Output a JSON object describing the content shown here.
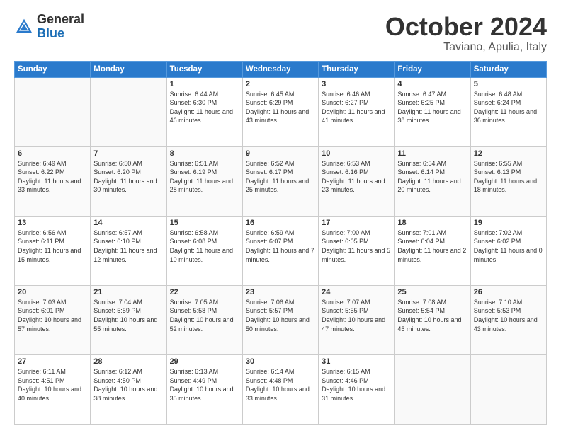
{
  "header": {
    "logo": {
      "general": "General",
      "blue": "Blue"
    },
    "title": "October 2024",
    "location": "Taviano, Apulia, Italy"
  },
  "weekdays": [
    "Sunday",
    "Monday",
    "Tuesday",
    "Wednesday",
    "Thursday",
    "Friday",
    "Saturday"
  ],
  "weeks": [
    [
      {
        "day": "",
        "info": ""
      },
      {
        "day": "",
        "info": ""
      },
      {
        "day": "1",
        "info": "Sunrise: 6:44 AM\nSunset: 6:30 PM\nDaylight: 11 hours and 46 minutes."
      },
      {
        "day": "2",
        "info": "Sunrise: 6:45 AM\nSunset: 6:29 PM\nDaylight: 11 hours and 43 minutes."
      },
      {
        "day": "3",
        "info": "Sunrise: 6:46 AM\nSunset: 6:27 PM\nDaylight: 11 hours and 41 minutes."
      },
      {
        "day": "4",
        "info": "Sunrise: 6:47 AM\nSunset: 6:25 PM\nDaylight: 11 hours and 38 minutes."
      },
      {
        "day": "5",
        "info": "Sunrise: 6:48 AM\nSunset: 6:24 PM\nDaylight: 11 hours and 36 minutes."
      }
    ],
    [
      {
        "day": "6",
        "info": "Sunrise: 6:49 AM\nSunset: 6:22 PM\nDaylight: 11 hours and 33 minutes."
      },
      {
        "day": "7",
        "info": "Sunrise: 6:50 AM\nSunset: 6:20 PM\nDaylight: 11 hours and 30 minutes."
      },
      {
        "day": "8",
        "info": "Sunrise: 6:51 AM\nSunset: 6:19 PM\nDaylight: 11 hours and 28 minutes."
      },
      {
        "day": "9",
        "info": "Sunrise: 6:52 AM\nSunset: 6:17 PM\nDaylight: 11 hours and 25 minutes."
      },
      {
        "day": "10",
        "info": "Sunrise: 6:53 AM\nSunset: 6:16 PM\nDaylight: 11 hours and 23 minutes."
      },
      {
        "day": "11",
        "info": "Sunrise: 6:54 AM\nSunset: 6:14 PM\nDaylight: 11 hours and 20 minutes."
      },
      {
        "day": "12",
        "info": "Sunrise: 6:55 AM\nSunset: 6:13 PM\nDaylight: 11 hours and 18 minutes."
      }
    ],
    [
      {
        "day": "13",
        "info": "Sunrise: 6:56 AM\nSunset: 6:11 PM\nDaylight: 11 hours and 15 minutes."
      },
      {
        "day": "14",
        "info": "Sunrise: 6:57 AM\nSunset: 6:10 PM\nDaylight: 11 hours and 12 minutes."
      },
      {
        "day": "15",
        "info": "Sunrise: 6:58 AM\nSunset: 6:08 PM\nDaylight: 11 hours and 10 minutes."
      },
      {
        "day": "16",
        "info": "Sunrise: 6:59 AM\nSunset: 6:07 PM\nDaylight: 11 hours and 7 minutes."
      },
      {
        "day": "17",
        "info": "Sunrise: 7:00 AM\nSunset: 6:05 PM\nDaylight: 11 hours and 5 minutes."
      },
      {
        "day": "18",
        "info": "Sunrise: 7:01 AM\nSunset: 6:04 PM\nDaylight: 11 hours and 2 minutes."
      },
      {
        "day": "19",
        "info": "Sunrise: 7:02 AM\nSunset: 6:02 PM\nDaylight: 11 hours and 0 minutes."
      }
    ],
    [
      {
        "day": "20",
        "info": "Sunrise: 7:03 AM\nSunset: 6:01 PM\nDaylight: 10 hours and 57 minutes."
      },
      {
        "day": "21",
        "info": "Sunrise: 7:04 AM\nSunset: 5:59 PM\nDaylight: 10 hours and 55 minutes."
      },
      {
        "day": "22",
        "info": "Sunrise: 7:05 AM\nSunset: 5:58 PM\nDaylight: 10 hours and 52 minutes."
      },
      {
        "day": "23",
        "info": "Sunrise: 7:06 AM\nSunset: 5:57 PM\nDaylight: 10 hours and 50 minutes."
      },
      {
        "day": "24",
        "info": "Sunrise: 7:07 AM\nSunset: 5:55 PM\nDaylight: 10 hours and 47 minutes."
      },
      {
        "day": "25",
        "info": "Sunrise: 7:08 AM\nSunset: 5:54 PM\nDaylight: 10 hours and 45 minutes."
      },
      {
        "day": "26",
        "info": "Sunrise: 7:10 AM\nSunset: 5:53 PM\nDaylight: 10 hours and 43 minutes."
      }
    ],
    [
      {
        "day": "27",
        "info": "Sunrise: 6:11 AM\nSunset: 4:51 PM\nDaylight: 10 hours and 40 minutes."
      },
      {
        "day": "28",
        "info": "Sunrise: 6:12 AM\nSunset: 4:50 PM\nDaylight: 10 hours and 38 minutes."
      },
      {
        "day": "29",
        "info": "Sunrise: 6:13 AM\nSunset: 4:49 PM\nDaylight: 10 hours and 35 minutes."
      },
      {
        "day": "30",
        "info": "Sunrise: 6:14 AM\nSunset: 4:48 PM\nDaylight: 10 hours and 33 minutes."
      },
      {
        "day": "31",
        "info": "Sunrise: 6:15 AM\nSunset: 4:46 PM\nDaylight: 10 hours and 31 minutes."
      },
      {
        "day": "",
        "info": ""
      },
      {
        "day": "",
        "info": ""
      }
    ]
  ]
}
